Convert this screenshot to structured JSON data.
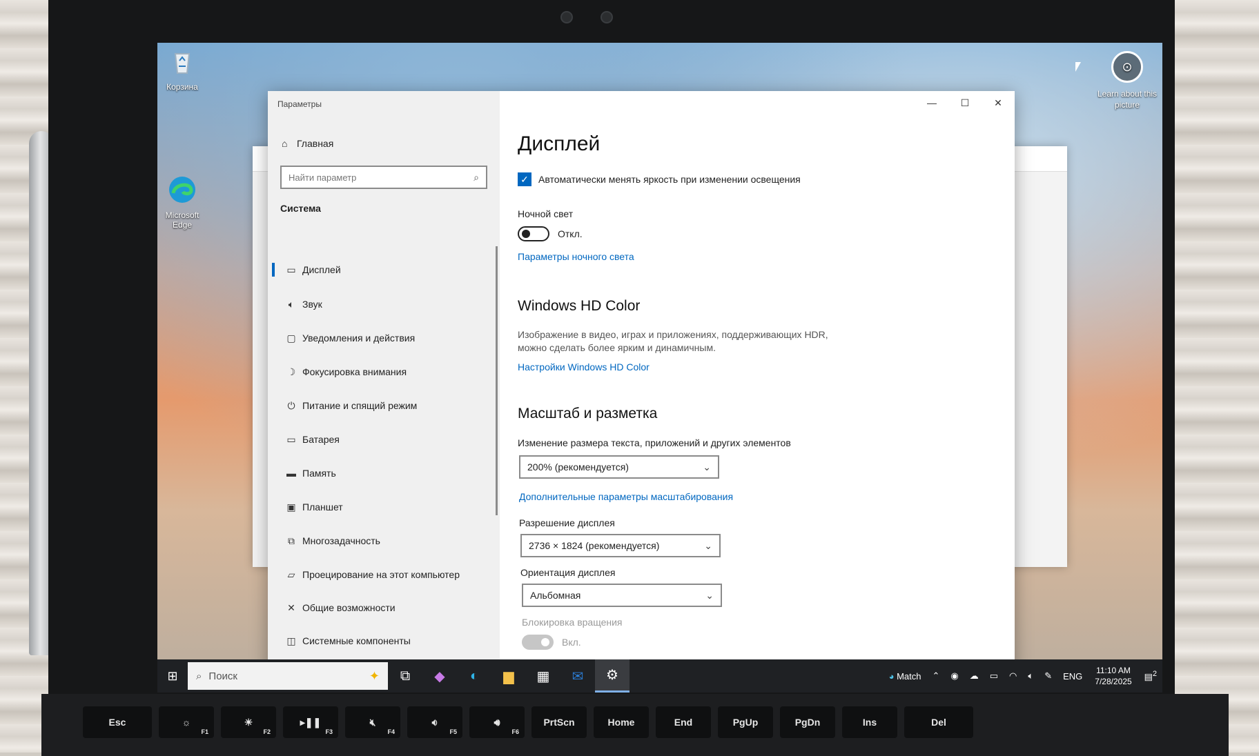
{
  "desktop": {
    "recycle_bin": "Корзина",
    "edge_label": "Microsoft Edge",
    "learn_about": "Learn about this picture"
  },
  "window": {
    "title": "Параметры",
    "minimize": "—",
    "maximize": "☐",
    "close": "✕"
  },
  "sidebar": {
    "home": "Главная",
    "search_placeholder": "Найти параметр",
    "section": "Система",
    "items": [
      {
        "label": "Дисплей",
        "icon": "monitor-icon"
      },
      {
        "label": "Звук",
        "icon": "speaker-icon"
      },
      {
        "label": "Уведомления и действия",
        "icon": "notification-icon"
      },
      {
        "label": "Фокусировка внимания",
        "icon": "moon-icon"
      },
      {
        "label": "Питание и спящий режим",
        "icon": "power-icon"
      },
      {
        "label": "Батарея",
        "icon": "battery-icon"
      },
      {
        "label": "Память",
        "icon": "storage-icon"
      },
      {
        "label": "Планшет",
        "icon": "tablet-icon"
      },
      {
        "label": "Многозадачность",
        "icon": "multitask-icon"
      },
      {
        "label": "Проецирование на этот компьютер",
        "icon": "project-icon"
      },
      {
        "label": "Общие возможности",
        "icon": "shared-icon"
      },
      {
        "label": "Системные компоненты",
        "icon": "components-icon"
      }
    ]
  },
  "main": {
    "title": "Дисплей",
    "auto_brightness": "Автоматически менять яркость при изменении освещения",
    "night_light_label": "Ночной свет",
    "night_light_state": "Откл.",
    "night_light_link": "Параметры ночного света",
    "hdr_title": "Windows HD Color",
    "hdr_desc": "Изображение в видео, играх и приложениях, поддерживающих HDR, можно сделать более ярким и динамичным.",
    "hdr_link": "Настройки Windows HD Color",
    "scale_title": "Масштаб и разметка",
    "scale_label": "Изменение размера текста, приложений и других элементов",
    "scale_value": "200% (рекомендуется)",
    "scale_link": "Дополнительные параметры масштабирования",
    "resolution_label": "Разрешение дисплея",
    "resolution_value": "2736 × 1824 (рекомендуется)",
    "orientation_label": "Ориентация дисплея",
    "orientation_value": "Альбомная",
    "rotation_lock_label": "Блокировка вращения",
    "rotation_lock_state": "Вкл."
  },
  "taskbar": {
    "search_placeholder": "Поиск",
    "match_label": "Match",
    "language": "ENG",
    "time": "11:10 AM",
    "date": "7/28/2025",
    "notification_count": "2"
  },
  "keyboard": [
    "Esc",
    "F1",
    "F2",
    "F3",
    "F4",
    "F5",
    "F6",
    "PrtScn",
    "Home",
    "End",
    "PgUp",
    "PgDn",
    "Ins",
    "Del"
  ],
  "colors": {
    "accent": "#0067c0",
    "taskbar": "#1f2124",
    "sidebar": "#f0f0f0"
  }
}
